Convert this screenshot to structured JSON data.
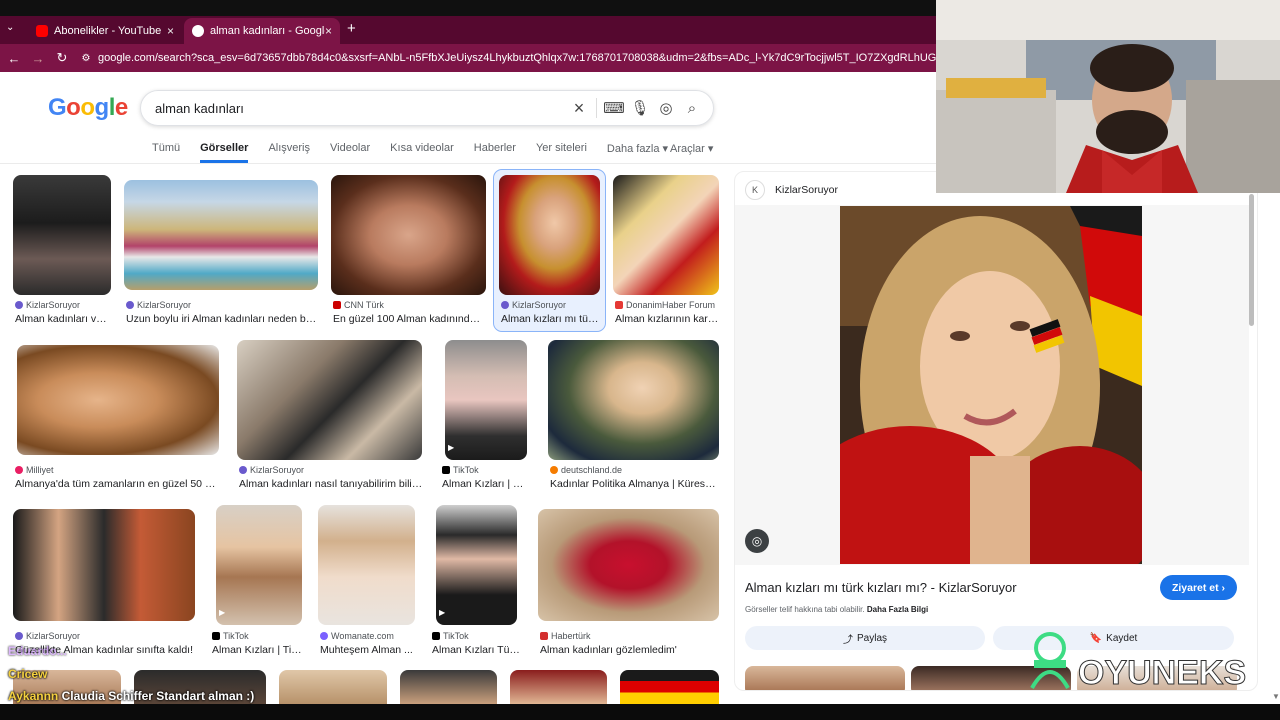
{
  "browser": {
    "tabs": [
      {
        "label": "Abonelikler - YouTube",
        "active": false,
        "icon": "youtube-icon"
      },
      {
        "label": "alman kadınları - Google'da Ara",
        "active": true,
        "icon": "google-icon"
      }
    ],
    "new_tab_symbol": "+",
    "url": "google.com/search?sca_esv=6d73657dbb78d4c0&sxsrf=ANbL-n5FfbXJeUiysz4LhykbuztQhlqx7w:1768701708038&udm=2&fbs=ADc_l-Yk7dC9rTocjjwl5T_IO7ZXgdRLhUG8pk-pM063RkPlLfDIfEXPwaXGSel"
  },
  "google": {
    "logo": "Google",
    "query": "alman kadınları",
    "tabs": [
      "Tümü",
      "Görseller",
      "Alışveriş",
      "Videolar",
      "Kısa videolar",
      "Haberler",
      "Yer siteleri",
      "Daha fazla"
    ],
    "active_tab": "Görseller",
    "tools_label": "Araçlar"
  },
  "results": [
    {
      "source": "KizlarSoruyor",
      "title": "Alman kadınları ve ..."
    },
    {
      "source": "KizlarSoruyor",
      "title": "Uzun boylu iri Alman kadınları neden bu k..."
    },
    {
      "source": "CNN Türk",
      "title": "En güzel 100 Alman kadınından ..."
    },
    {
      "source": "KizlarSoruyor",
      "title": "Alman kızları mı tür..."
    },
    {
      "source": "DonanimHaber Forum",
      "title": "Alman kızlarının kara..."
    },
    {
      "source": "Milliyet",
      "title": "Almanya'da tüm zamanların en güzel 50 kadı..."
    },
    {
      "source": "KizlarSoruyor",
      "title": "Alman kadınları nasıl tanıyabilirim biliyor..."
    },
    {
      "source": "TikTok",
      "title": "Alman Kızları | Tik..."
    },
    {
      "source": "deutschland.de",
      "title": "Kadınlar Politika Almanya | Küresel ..."
    },
    {
      "source": "KizlarSoruyor",
      "title": "Güzellikte Alman kadınlar sınıfta kaldı!"
    },
    {
      "source": "TikTok",
      "title": "Alman Kızları | TikT..."
    },
    {
      "source": "Womanate.com",
      "title": "Muhteşem Alman ..."
    },
    {
      "source": "TikTok",
      "title": "Alman Kızları Türk ..."
    },
    {
      "source": "Habertürk",
      "title": "Alman kadınları gözlemledim'"
    }
  ],
  "panel": {
    "site": "KizlarSoruyor",
    "title": "Alman kızları mı türk kızları mı? - KizlarSoruyor",
    "visit_label": "Ziyaret et",
    "note": "Görseller telif hakkına tabi olabilir.",
    "note_link": "Daha Fazla Bilgi",
    "share_label": "Paylaş",
    "save_label": "Kaydet"
  },
  "stream_overlay": {
    "chat": [
      {
        "user": "Eiffel... (chat)",
        "text": "Eduardo...",
        "color": "#c58af9"
      },
      {
        "user": "Cricew",
        "text": "",
        "color": "#f4d03f"
      },
      {
        "user": "Aykannn",
        "text": "Claudia Schiffer Standart alman :)",
        "color": "#f4d03f"
      }
    ],
    "watermark": "OYUNEKS"
  },
  "colors": {
    "tabbar": "#55082f",
    "address_bar": "#7c1446",
    "accent": "#1a73e8"
  }
}
